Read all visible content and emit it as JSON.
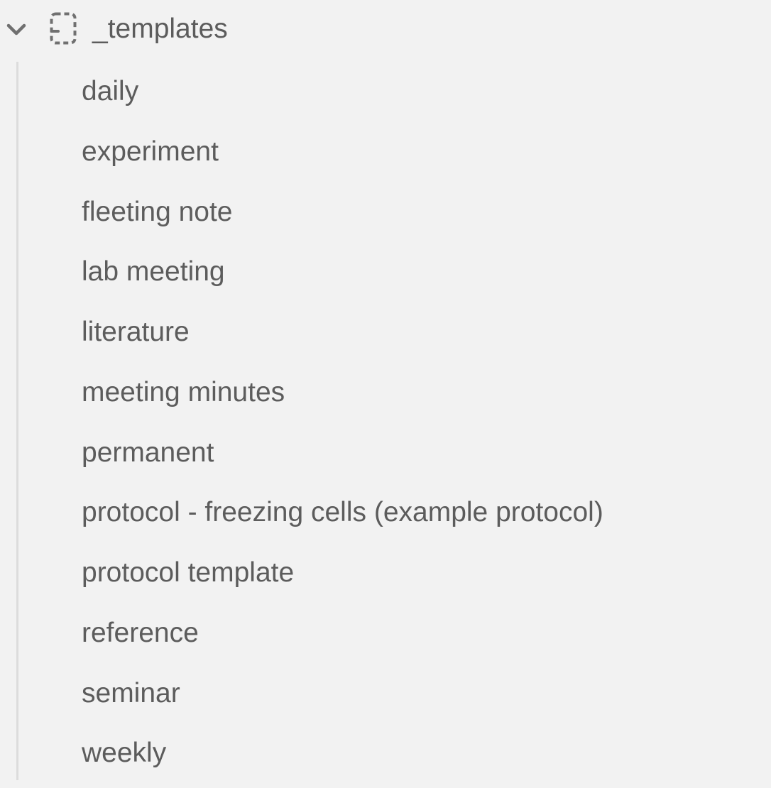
{
  "folder": {
    "name": "_templates",
    "collapse_icon": "chevron-down-icon",
    "folder_icon": "dashed-folder-icon",
    "expanded": true
  },
  "files": [
    "daily",
    "experiment",
    "fleeting note",
    "lab meeting",
    "literature",
    "meeting minutes",
    "permanent",
    "protocol - freezing cells (example protocol)",
    "protocol template",
    "reference",
    "seminar",
    "weekly"
  ],
  "colors": {
    "background": "#f2f2f2",
    "text": "#5c5c5c",
    "icon": "#707070",
    "guide_line": "#dcdcdc"
  }
}
